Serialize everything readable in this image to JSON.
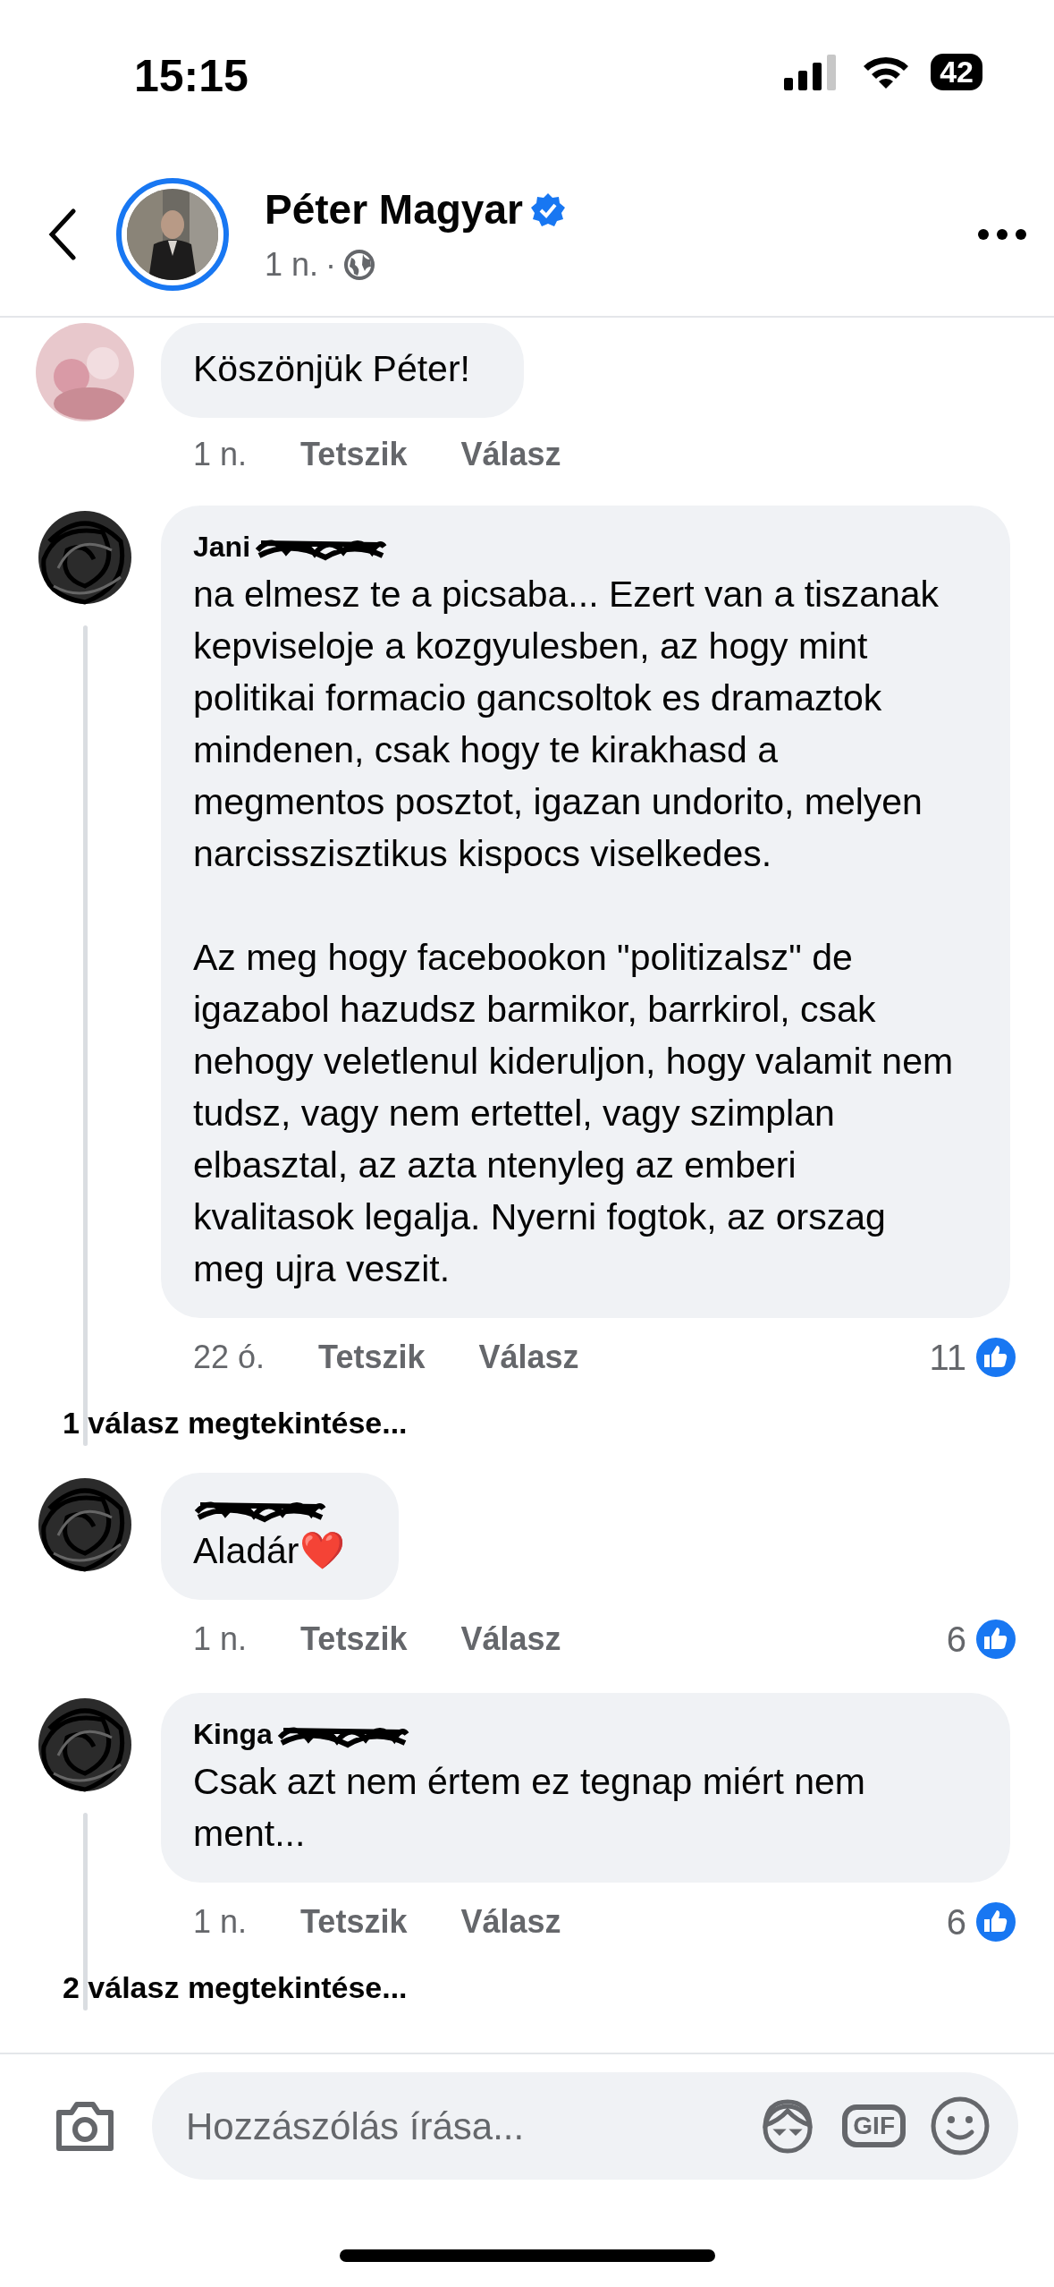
{
  "status_bar": {
    "time": "15:15",
    "battery": "42"
  },
  "post_header": {
    "author": "Péter Magyar",
    "verified": true,
    "time": "1 n.",
    "separator": "·"
  },
  "comments": [
    {
      "redacted": false,
      "text": "Köszönjük Péter!",
      "time": "1 n.",
      "like_label": "Tetszik",
      "reply_label": "Válasz"
    },
    {
      "kind": "scribbled",
      "author": "Jani",
      "redacted": true,
      "text": "na elmesz te a picsaba... Ezert van a tiszanak kepviseloje a kozgyulesben, az hogy mint politikai formacio gancsoltok es dramaztok mindenen, csak hogy te kirakhasd a megmentos posztot, igazan undorito, melyen narcisszisztikus kispocs viselkedes.\n\nAz meg hogy facebookon \"politizalsz\" de igazabol hazudsz barmikor, barrkirol, csak nehogy veletlenul kideruljon, hogy valamit nem tudsz, vagy nem ertettel, vagy szimplan elbasztal, az azta ntenyleg az emberi kvalitasok legalja. Nyerni fogtok, az orszag meg ujra veszit.",
      "time": "22 ó.",
      "like_label": "Tetszik",
      "reply_label": "Válasz",
      "likes": "11",
      "view_replies": "1 válasz megtekintése..."
    },
    {
      "kind": "scribbled",
      "redacted": true,
      "text": "Aladár❤️",
      "time": "1 n.",
      "like_label": "Tetszik",
      "reply_label": "Válasz",
      "likes": "6"
    },
    {
      "kind": "scribbled",
      "author": "Kinga",
      "redacted": true,
      "text": "Csak azt nem értem ez tegnap miért nem ment...",
      "time": "1 n.",
      "like_label": "Tetszik",
      "reply_label": "Válasz",
      "likes": "6",
      "view_replies": "2 válasz megtekintése..."
    }
  ],
  "composer": {
    "placeholder": "Hozzászólás írása...",
    "gif_label": "GIF"
  }
}
